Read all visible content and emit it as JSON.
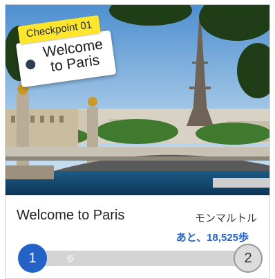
{
  "badge": {
    "tag": "Checkpoint 01",
    "title": "Welcome to Paris"
  },
  "checkpoint": {
    "title": "Welcome to Paris",
    "destination": "モンマルトル",
    "remaining": "あと、18,525歩",
    "unit": "歩",
    "start": "1",
    "end": "2",
    "progress_fraction": 0.04
  },
  "colors": {
    "accent": "#2462c8",
    "badge": "#ffe52b",
    "track": "#d4d4d4"
  }
}
